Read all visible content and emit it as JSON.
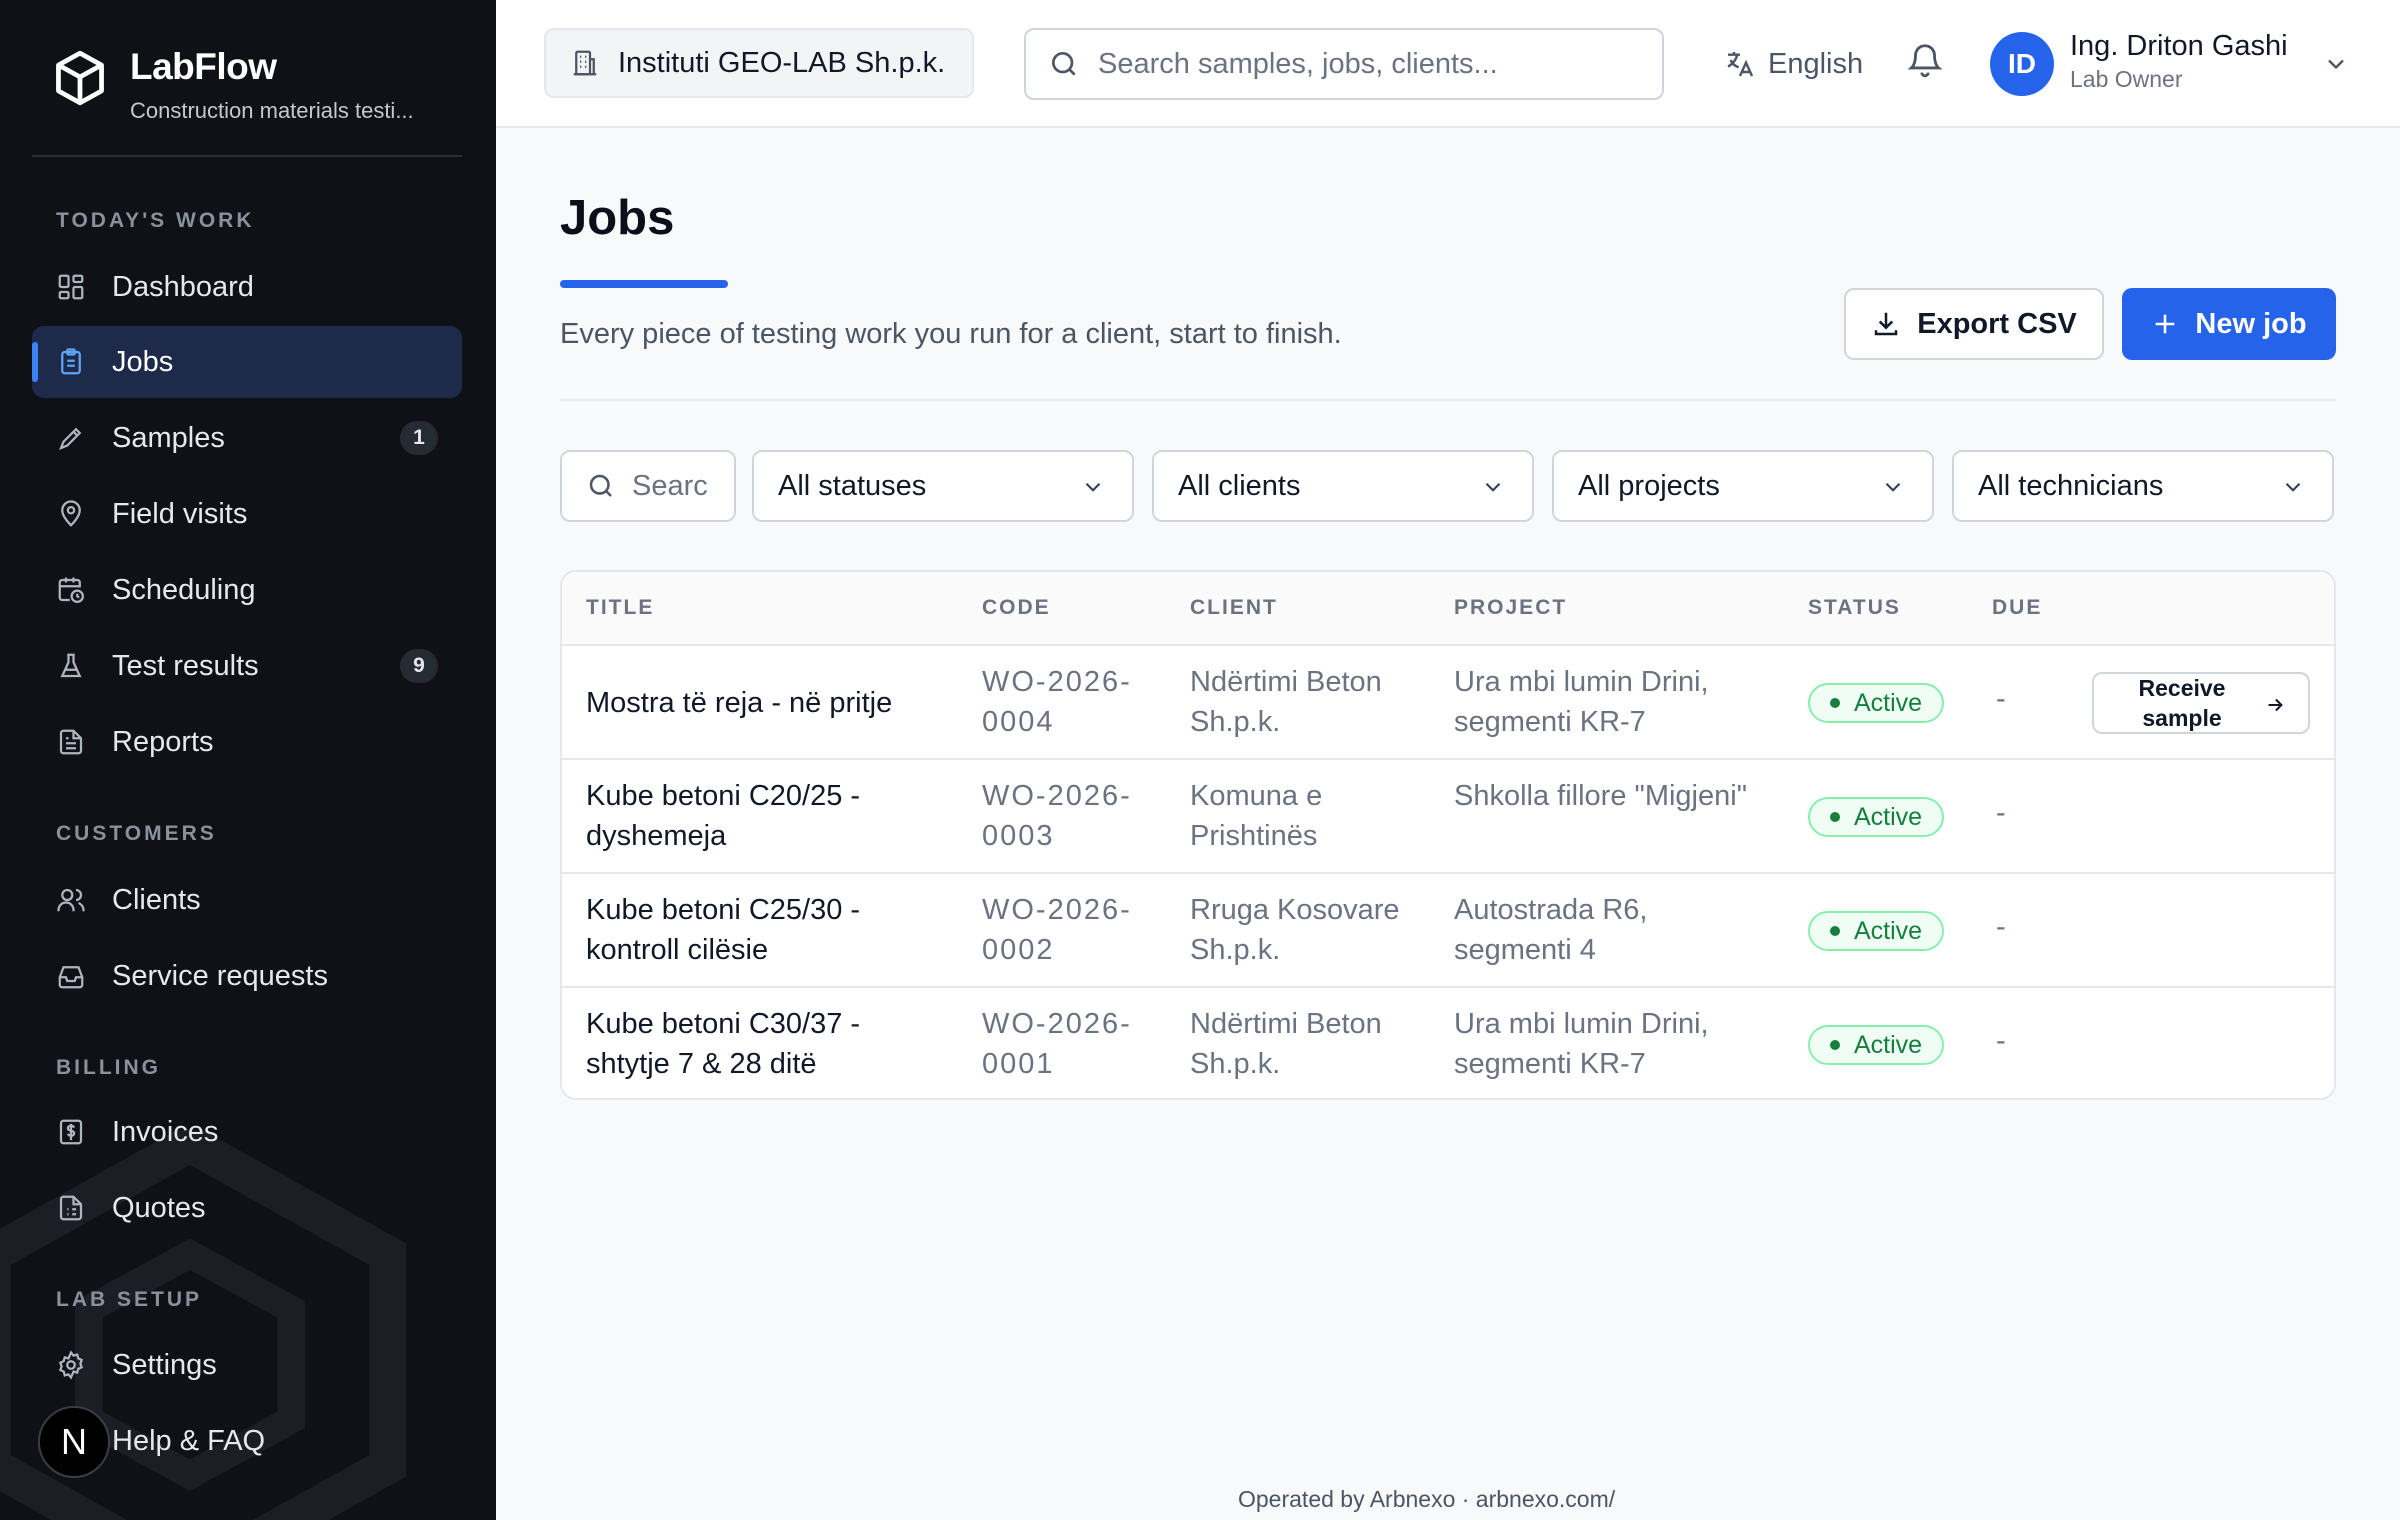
{
  "app": {
    "name": "LabFlow",
    "subtitle": "Construction materials testi..."
  },
  "sidebar": {
    "sections": [
      {
        "label": "TODAY'S WORK"
      },
      {
        "label": "CUSTOMERS"
      },
      {
        "label": "BILLING"
      },
      {
        "label": "LAB SETUP"
      }
    ],
    "items": [
      {
        "label": "Dashboard",
        "icon": "dashboard-icon"
      },
      {
        "label": "Jobs",
        "icon": "clipboard-icon",
        "active": true
      },
      {
        "label": "Samples",
        "icon": "pipette-icon",
        "badge": "1"
      },
      {
        "label": "Field visits",
        "icon": "map-pin-icon"
      },
      {
        "label": "Scheduling",
        "icon": "calendar-clock-icon"
      },
      {
        "label": "Test results",
        "icon": "flask-icon",
        "badge": "9"
      },
      {
        "label": "Reports",
        "icon": "file-text-icon"
      },
      {
        "label": "Clients",
        "icon": "users-icon"
      },
      {
        "label": "Service requests",
        "icon": "inbox-icon"
      },
      {
        "label": "Invoices",
        "icon": "invoice-icon"
      },
      {
        "label": "Quotes",
        "icon": "quote-icon"
      },
      {
        "label": "Settings",
        "icon": "gear-icon"
      },
      {
        "label": "Help & FAQ",
        "icon": "help-icon"
      }
    ],
    "avatar_letter": "N"
  },
  "topbar": {
    "org": "Instituti GEO-LAB Sh.p.k.",
    "search_placeholder": "Search samples, jobs, clients...",
    "language": "English",
    "user_initials": "ID",
    "user_name": "Ing. Driton Gashi",
    "user_role": "Lab Owner"
  },
  "page": {
    "title": "Jobs",
    "subtitle": "Every piece of testing work you run for a client, start to finish.",
    "export_label": "Export CSV",
    "new_label": "New job"
  },
  "filters": {
    "search_placeholder": "Searc",
    "status": "All statuses",
    "client": "All clients",
    "project": "All projects",
    "technician": "All technicians"
  },
  "table": {
    "columns": [
      "TITLE",
      "CODE",
      "CLIENT",
      "PROJECT",
      "STATUS",
      "DUE"
    ],
    "rows": [
      {
        "title": "Mostra të reja - në pritje",
        "code": "WO-2026-0004",
        "client": "Ndërtimi Beton Sh.p.k.",
        "project": "Ura mbi lumin Drini, segmenti KR-7",
        "status": "Active",
        "due": "-",
        "action": "Receive sample"
      },
      {
        "title": "Kube betoni C20/25 - dyshemeja",
        "code": "WO-2026-0003",
        "client": "Komuna e Prishtinës",
        "project": "Shkolla fillore \"Migjeni\"",
        "status": "Active",
        "due": "-"
      },
      {
        "title": "Kube betoni C25/30 - kontroll cilësie",
        "code": "WO-2026-0002",
        "client": "Rruga Kosovare Sh.p.k.",
        "project": "Autostrada R6, segmenti 4",
        "status": "Active",
        "due": "-"
      },
      {
        "title": "Kube betoni C30/37 - shtytje 7 & 28 ditë",
        "code": "WO-2026-0001",
        "client": "Ndërtimi Beton Sh.p.k.",
        "project": "Ura mbi lumin Drini, segmenti KR-7",
        "status": "Active",
        "due": "-"
      }
    ]
  },
  "footer": "Operated by Arbnexo · arbnexo.com/",
  "colors": {
    "accent": "#2563eb",
    "sidebar_bg": "#0f1117",
    "status_active": "#15803d"
  }
}
